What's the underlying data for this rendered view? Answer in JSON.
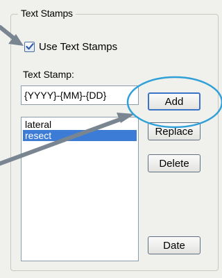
{
  "group": {
    "title": "Text Stamps"
  },
  "use_stamps": {
    "label": "Use Text Stamps",
    "checked": true
  },
  "stamp_field": {
    "label": "Text Stamp:",
    "value": "{YYYY}-{MM}-{DD}"
  },
  "stamp_list": {
    "items": [
      {
        "label": "lateral",
        "selected": false
      },
      {
        "label": "resect",
        "selected": true
      }
    ]
  },
  "buttons": {
    "add": "Add",
    "replace": "Replace",
    "delete": "Delete",
    "date": "Date"
  },
  "colors": {
    "callout_arrow": "#7a8592",
    "highlight_circle": "#2fa0d8",
    "selection": "#3d7cd6"
  }
}
